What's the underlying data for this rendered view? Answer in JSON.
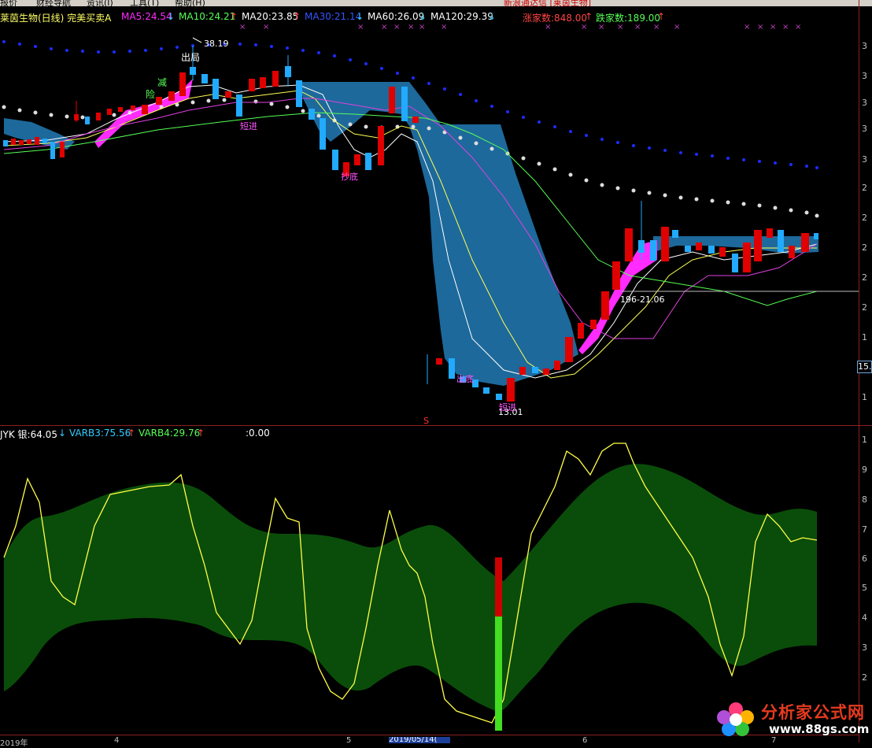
{
  "menu": {
    "items": [
      "报价",
      "财经导航",
      "资讯(I)",
      "工具(T)",
      "帮助(H)"
    ],
    "news_title": "新浪通达信 [莱茵生物]"
  },
  "legend": {
    "title": "莱茵生物(日线) 完美买卖A",
    "ma5": "MA5:24.54",
    "ma10": "MA10:24.21",
    "ma20": "MA20:23.85",
    "ma30": "MA30:21.14",
    "ma60": "MA60:26.09",
    "ma120": "MA120:29.39",
    "rise_count": "涨家数:848.00",
    "fall_count": "跌家数:189.00",
    "arrow_down": "↓",
    "arrow_up": "↑"
  },
  "annotations": {
    "high": "38.19",
    "exit": "出局",
    "reduce": "减",
    "risk": "险",
    "trap1": "短进",
    "trap2": "抄底",
    "range": "196-21.06",
    "low": "13.01",
    "fill1": "出底",
    "fill2": "短进",
    "s_marker": "S"
  },
  "sub_legend": {
    "jyk": "JYK 银:64.05",
    "varb3": "VARB3:75.56",
    "varb4": "VARB4:29.76",
    "extra": ":0.00"
  },
  "axis": {
    "price_labels": [
      "3",
      "3",
      "3",
      "3",
      "3",
      "2",
      "2",
      "2",
      "2",
      "2",
      "1",
      "1",
      "1"
    ],
    "sub_labels": [
      "1",
      "9",
      "8",
      "7",
      "6",
      "5",
      "4",
      "3",
      "2"
    ],
    "current_price": "15."
  },
  "bottom": {
    "date": "2019/05/14(",
    "labels": [
      "2019年",
      "4",
      "5",
      "6",
      "7"
    ]
  },
  "watermark": {
    "title": "分析家公式网",
    "url": "www.88gs.com"
  },
  "colors": {
    "ma5": "#ff2bff",
    "ma10": "#ffffff",
    "ma20": "#ffff55",
    "ma30": "#55ff55",
    "band": "#1f6fa3",
    "up": "#e00000",
    "down": "#22aaff",
    "green_area": "#0a4d0a"
  }
}
